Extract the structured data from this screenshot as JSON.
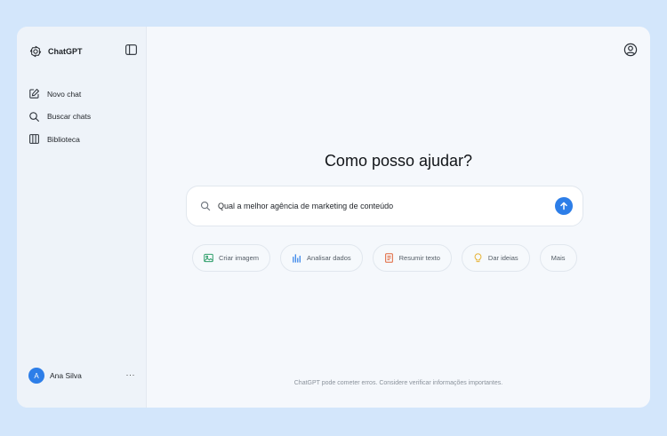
{
  "sidebar": {
    "brand_name": "ChatGPT",
    "items": [
      {
        "label": "Novo chat",
        "icon": "edit-icon"
      },
      {
        "label": "Buscar chats",
        "icon": "search-icon"
      },
      {
        "label": "Biblioteca",
        "icon": "library-icon"
      }
    ],
    "user": {
      "initial": "A",
      "name": "Ana Silva",
      "more": "···"
    }
  },
  "main": {
    "headline": "Como posso ajudar?",
    "search": {
      "value": "Qual a melhor agência de marketing de conteúdo"
    },
    "chips": [
      {
        "label": "Criar imagem",
        "icon": "image-icon",
        "color": "#2f9e6a"
      },
      {
        "label": "Analisar dados",
        "icon": "bar-chart-icon",
        "color": "#2d7ee8"
      },
      {
        "label": "Resumir texto",
        "icon": "document-icon",
        "color": "#e0663b"
      },
      {
        "label": "Dar ideias",
        "icon": "lightbulb-icon",
        "color": "#e7b43a"
      },
      {
        "label": "Mais"
      }
    ],
    "footer_note": "ChatGPT pode cometer erros. Considere verificar informações importantes."
  },
  "colors": {
    "accent": "#2d7ee8",
    "background": "#d3e6fb"
  }
}
